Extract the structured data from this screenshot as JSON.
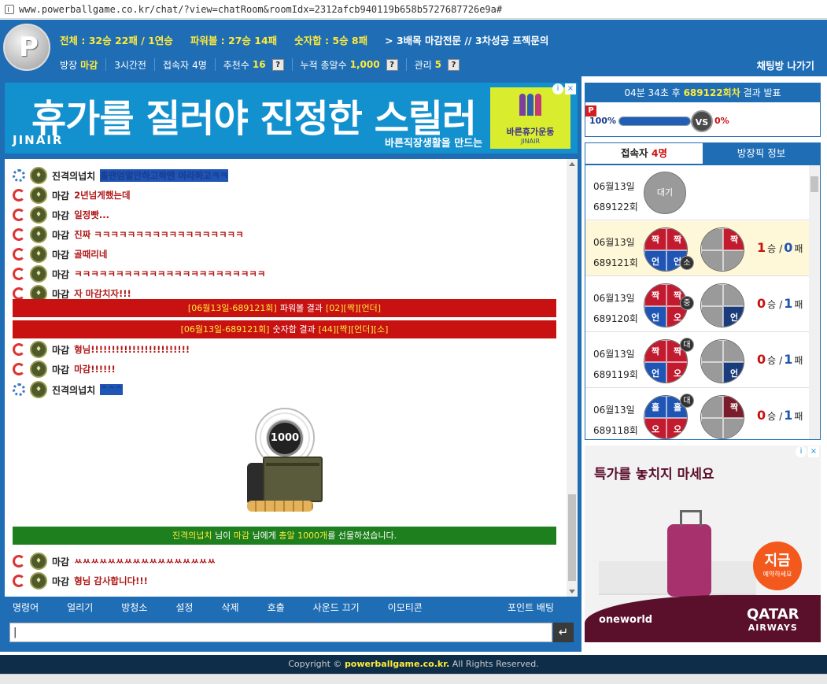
{
  "browser": {
    "url": "www.powerballgame.co.kr/chat/?view=chatRoom&roomIdx=2312afcb940119b658b5727687726e9a#"
  },
  "header": {
    "logo_letter": "P",
    "total_label": "전체 : 32승 22패 / 1연승",
    "powerball_label": "파워볼 : 27승 14패",
    "sum_label": "숫자합 : 5승 8패",
    "room_title": "> 3배목 마감전문 // 3차성공 프젝문의",
    "owner_label": "방장",
    "owner_value": "마감",
    "tenure": "3시간전",
    "users_label": "접속자",
    "users_value": "4명",
    "recommend_label": "추천수",
    "recommend_value": "16",
    "bullets_label": "누적 총알수",
    "bullets_value": "1,000",
    "manage_label": "관리",
    "manage_value": "5",
    "help": "?",
    "exit": "채팅방 나가기"
  },
  "ad_top": {
    "headline": "휴가를 질러야 진정한 스릴러",
    "brand": "JINAIR",
    "sub": "바른직장생활을 만드는",
    "box_label": "바른휴가운동",
    "box_sub": "JINAIR",
    "info": "i",
    "close": "×"
  },
  "chat": [
    {
      "type": "msg",
      "role": "user",
      "level": "♦",
      "nick": "진격의넙치",
      "text": "홀땐엄말안하고짝땐 머라하고ㅋㅋ",
      "color": "blue"
    },
    {
      "type": "msg",
      "role": "admin",
      "level": "♦",
      "nick": "마감",
      "text": "2년넘게했는데",
      "color": "red"
    },
    {
      "type": "msg",
      "role": "admin",
      "level": "♦",
      "nick": "마감",
      "text": "일정빳...",
      "color": "red"
    },
    {
      "type": "msg",
      "role": "admin",
      "level": "♦",
      "nick": "마감",
      "text": "진짜 ㅋㅋㅋㅋㅋㅋㅋㅋㅋㅋㅋㅋㅋㅋㅋㅋㅋㅋ",
      "color": "red"
    },
    {
      "type": "msg",
      "role": "admin",
      "level": "♦",
      "nick": "마감",
      "text": "골때리네",
      "color": "red"
    },
    {
      "type": "msg",
      "role": "admin",
      "level": "♦",
      "nick": "마감",
      "text": "ㅋㅋㅋㅋㅋㅋㅋㅋㅋㅋㅋㅋㅋㅋㅋㅋㅋㅋㅋㅋㅋㅋㅋ",
      "color": "red"
    },
    {
      "type": "msg",
      "role": "admin",
      "level": "♦",
      "nick": "마감",
      "text": "자 마감치자!!!",
      "color": "red"
    },
    {
      "type": "sys",
      "tag": "[06월13일-689121회]",
      "body": "파워볼 결과",
      "r1": "[02]",
      "r2": "[짝]",
      "r3": "[언더]",
      "r4": ""
    },
    {
      "type": "sys",
      "tag": "[06월13일-689121회]",
      "body": "숫자합 결과",
      "r1": "[44]",
      "r2": "[짝]",
      "r3": "[언더]",
      "r4": "[소]"
    },
    {
      "type": "msg",
      "role": "admin",
      "level": "♦",
      "nick": "마감",
      "text": "형님!!!!!!!!!!!!!!!!!!!!!!!!",
      "color": "red"
    },
    {
      "type": "msg",
      "role": "admin",
      "level": "♦",
      "nick": "마감",
      "text": "마감!!!!!!",
      "color": "red"
    },
    {
      "type": "msg",
      "role": "user",
      "level": "♦",
      "nick": "진격의넙치",
      "text": "^^^",
      "color": "blue"
    },
    {
      "type": "msg",
      "role": "admin",
      "level": "♦",
      "nick": "마감",
      "text": "ㅆㅆㅆㅆㅆㅆㅆㅆㅆㅆㅆㅆㅆㅆㅆㅆㅆ",
      "color": "red"
    },
    {
      "type": "msg",
      "role": "admin",
      "level": "♦",
      "nick": "마감",
      "text": "형님 감사합니다!!!",
      "color": "red"
    }
  ],
  "gift_image": {
    "coin_value": "1000"
  },
  "gift_msg": {
    "sender": "진격의넙치",
    "p1": "님이",
    "receiver": "마감",
    "p2": "님에게",
    "item": "총알 1000개",
    "p3": "를 선물하셨습니다."
  },
  "menu": [
    "명령어",
    "얼리기",
    "방청소",
    "설정",
    "삭제",
    "호출",
    "사운드 끄기",
    "이모티콘"
  ],
  "menu_point": "포인트 배팅",
  "input": {
    "value": "|",
    "enter_icon": "↵"
  },
  "result": {
    "timer_prefix": "04분 34초 후",
    "timer_round": "689122회차",
    "timer_suffix": "결과 발표",
    "p_badge": "P",
    "left_pct": "100%",
    "vs": "VS",
    "right_pct": "0%",
    "progress": 1.0
  },
  "tabs": {
    "users_label": "접속자",
    "users_value": "4명",
    "picks_label": "방장픽 정보"
  },
  "picks": [
    {
      "date": "06월13일",
      "round": "689122회",
      "wait": "대기"
    },
    {
      "date": "06월13일",
      "round": "689121회",
      "q": [
        "짝",
        "짝",
        "언",
        "언"
      ],
      "qc": [
        "red",
        "red",
        "blue",
        "blue"
      ],
      "tag": "소",
      "tagPos": "bottom",
      "q2": [
        "",
        "짝",
        "",
        ""
      ],
      "q2c": [
        "grey",
        "red",
        "grey",
        "grey"
      ],
      "win": "1",
      "win_lbl": "승",
      "sep": "/",
      "lose": "0",
      "lose_lbl": "패",
      "hl": true
    },
    {
      "date": "06월13일",
      "round": "689120회",
      "q": [
        "짝",
        "짝",
        "언",
        "오"
      ],
      "qc": [
        "red",
        "red",
        "blue",
        "red"
      ],
      "tag": "중",
      "tagPos": "mid",
      "q2": [
        "",
        "",
        "",
        "언"
      ],
      "q2c": [
        "grey",
        "grey",
        "grey",
        "dblue"
      ],
      "win": "0",
      "win_lbl": "승",
      "sep": "/",
      "lose": "1",
      "lose_lbl": "패"
    },
    {
      "date": "06월13일",
      "round": "689119회",
      "q": [
        "짝",
        "짝",
        "언",
        "오"
      ],
      "qc": [
        "red",
        "red",
        "blue",
        "red"
      ],
      "tag": "대",
      "tagPos": "top",
      "q2": [
        "",
        "",
        "",
        "언"
      ],
      "q2c": [
        "grey",
        "grey",
        "grey",
        "dblue"
      ],
      "win": "0",
      "win_lbl": "승",
      "sep": "/",
      "lose": "1",
      "lose_lbl": "패"
    },
    {
      "date": "06월13일",
      "round": "689118회",
      "q": [
        "홀",
        "홀",
        "오",
        "오"
      ],
      "qc": [
        "blue",
        "blue",
        "red",
        "red"
      ],
      "tag": "대",
      "tagPos": "top",
      "q2": [
        "",
        "짝",
        "",
        ""
      ],
      "q2c": [
        "grey",
        "dred",
        "grey",
        "grey"
      ],
      "win": "0",
      "win_lbl": "승",
      "sep": "/",
      "lose": "1",
      "lose_lbl": "패"
    }
  ],
  "ad_right": {
    "headline": "특가를 놓치지 마세요",
    "badge": "지금",
    "badge_sub": "예약하세요",
    "oneworld": "oneworld",
    "qatar": "QATAR",
    "airways": "AIRWAYS",
    "info": "i",
    "close": "×"
  },
  "footer": {
    "prefix": "Copyright ©",
    "site": "powerballgame.co.kr.",
    "suffix": "All Rights Reserved."
  }
}
